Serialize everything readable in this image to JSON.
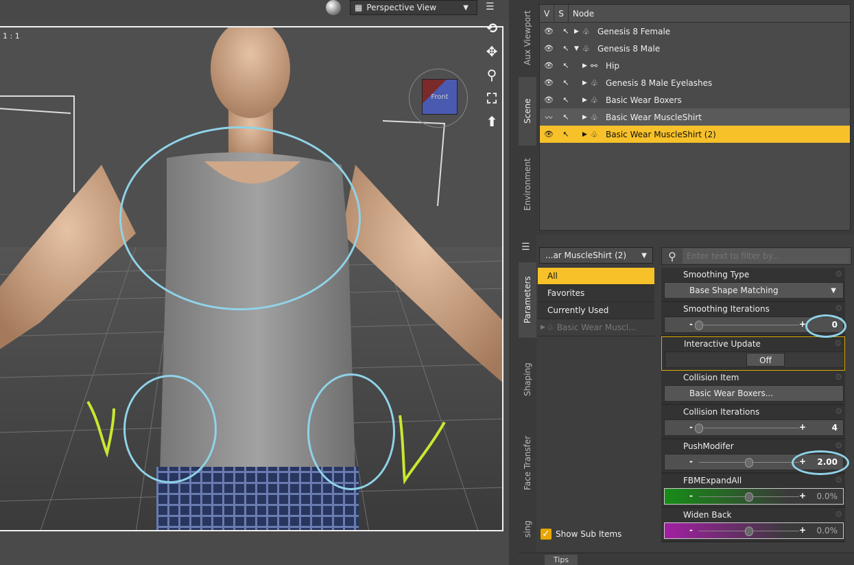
{
  "viewport": {
    "view_name": "Perspective View",
    "ratio": "1 : 1",
    "cube_label": "Front"
  },
  "side_tabs_top": [
    "Aux Viewport",
    "Scene",
    "Environment"
  ],
  "side_tabs_bottom": [
    "Parameters",
    "Shaping",
    "Face Transfer",
    "sing"
  ],
  "scene": {
    "headers": [
      "V",
      "S",
      "Node"
    ],
    "nodes": [
      {
        "label": "Genesis 8 Female",
        "indent": 0
      },
      {
        "label": "Genesis 8 Male",
        "indent": 0
      },
      {
        "label": "Hip",
        "indent": 1
      },
      {
        "label": "Genesis 8 Male Eyelashes",
        "indent": 1
      },
      {
        "label": "Basic Wear Boxers",
        "indent": 1
      },
      {
        "label": "Basic Wear MuscleShirt",
        "indent": 1
      },
      {
        "label": "Basic Wear MuscleShirt (2)",
        "indent": 1
      }
    ]
  },
  "parameters": {
    "node_select": "...ar MuscleShirt (2)",
    "categories": [
      "All",
      "Favorites",
      "Currently Used",
      "Basic Wear Muscl..."
    ],
    "filter_placeholder": "Enter text to filter by...",
    "show_sub_items": "Show Sub Items",
    "items": {
      "smoothing_type": {
        "label": "Smoothing Type",
        "value": "Base Shape Matching"
      },
      "smoothing_iterations": {
        "label": "Smoothing Iterations",
        "value": "0",
        "fraction": 0.0
      },
      "interactive_update": {
        "label": "Interactive Update",
        "value": "Off"
      },
      "collision_item": {
        "label": "Collision Item",
        "value": "Basic Wear Boxers..."
      },
      "collision_iterations": {
        "label": "Collision Iterations",
        "value": "4",
        "fraction": 0.0
      },
      "push_modifier": {
        "label": "PushModifer",
        "value": "2.00",
        "fraction": 0.5
      },
      "fbm_expand_all": {
        "label": "FBMExpandAll",
        "value": "0.0%",
        "fraction": 0.5
      },
      "widen_back": {
        "label": "Widen Back",
        "value": "0.0%",
        "fraction": 0.5
      }
    }
  },
  "tips": {
    "label": "Tips"
  },
  "colors": {
    "accent": "#f7c12a",
    "annotation": "#8fd3e8",
    "check": "#c8e830"
  }
}
